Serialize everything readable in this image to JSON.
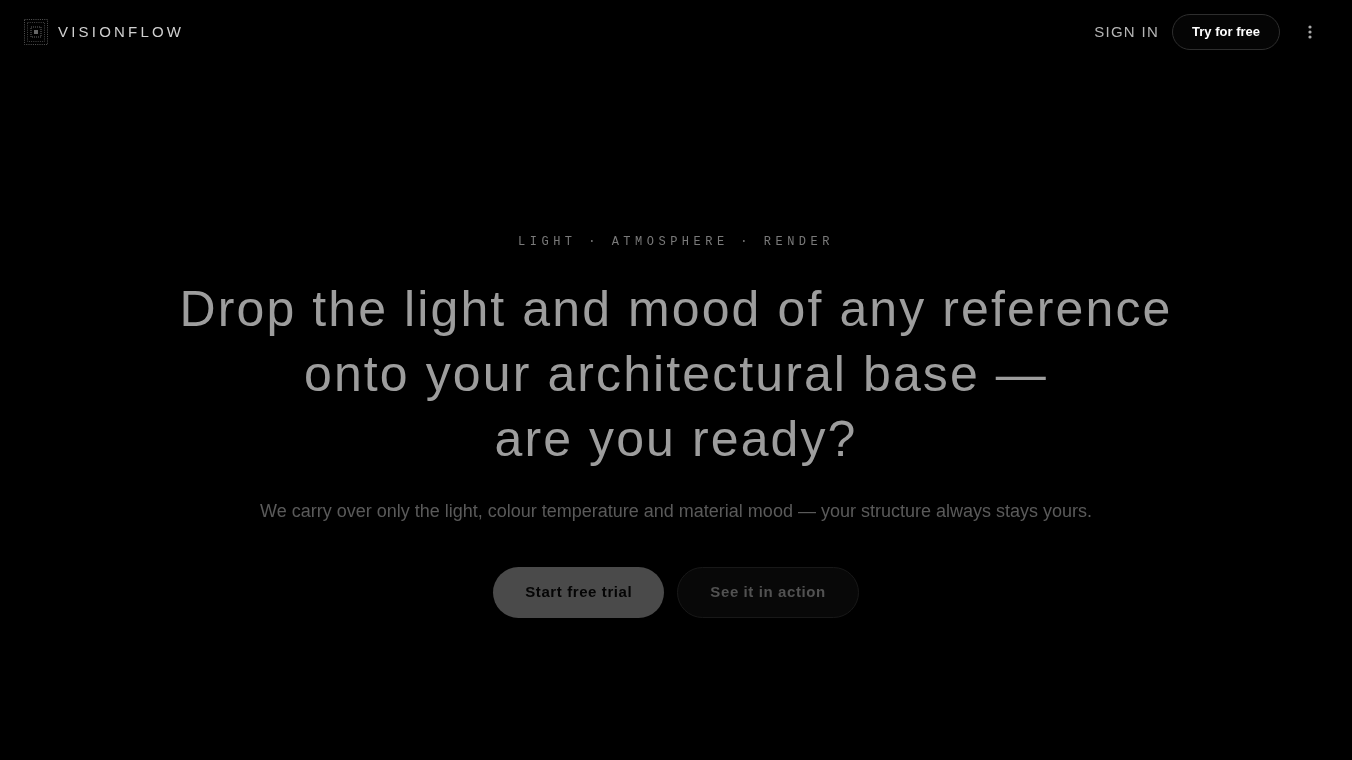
{
  "brand": {
    "name": "VISIONFLOW"
  },
  "nav": {
    "sign_in": "SIGN IN",
    "cta": "Try for free"
  },
  "hero": {
    "eyebrow": "LIGHT · ATMOSPHERE · RENDER",
    "headline_lines": [
      "Drop the light and mood of any reference",
      "onto your architectural base —",
      "are you ready?"
    ],
    "subtitle": "We carry over only the light, colour temperature and material mood — your structure always stays yours.",
    "buttons": [
      {
        "label": "Start free trial",
        "kind": "primary"
      },
      {
        "label": "See it in action",
        "kind": "secondary"
      }
    ]
  }
}
